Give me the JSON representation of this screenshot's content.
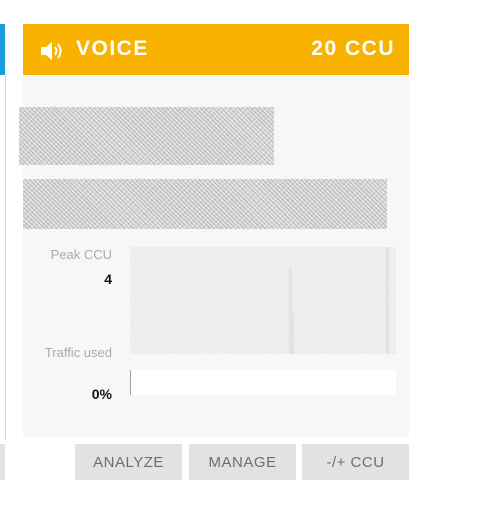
{
  "card": {
    "title": "VOICE",
    "ccu_badge": "20 CCU",
    "header_icon": "speaker-icon",
    "header_color": "#f8b200"
  },
  "stats": {
    "peak_label": "Peak CCU",
    "peak_value": "4",
    "traffic_label": "Traffic used",
    "traffic_value": "0%",
    "traffic_fraction": 0
  },
  "actions": {
    "analyze": "ANALYZE",
    "manage": "MANAGE",
    "ccu": "-/+ CCU"
  }
}
